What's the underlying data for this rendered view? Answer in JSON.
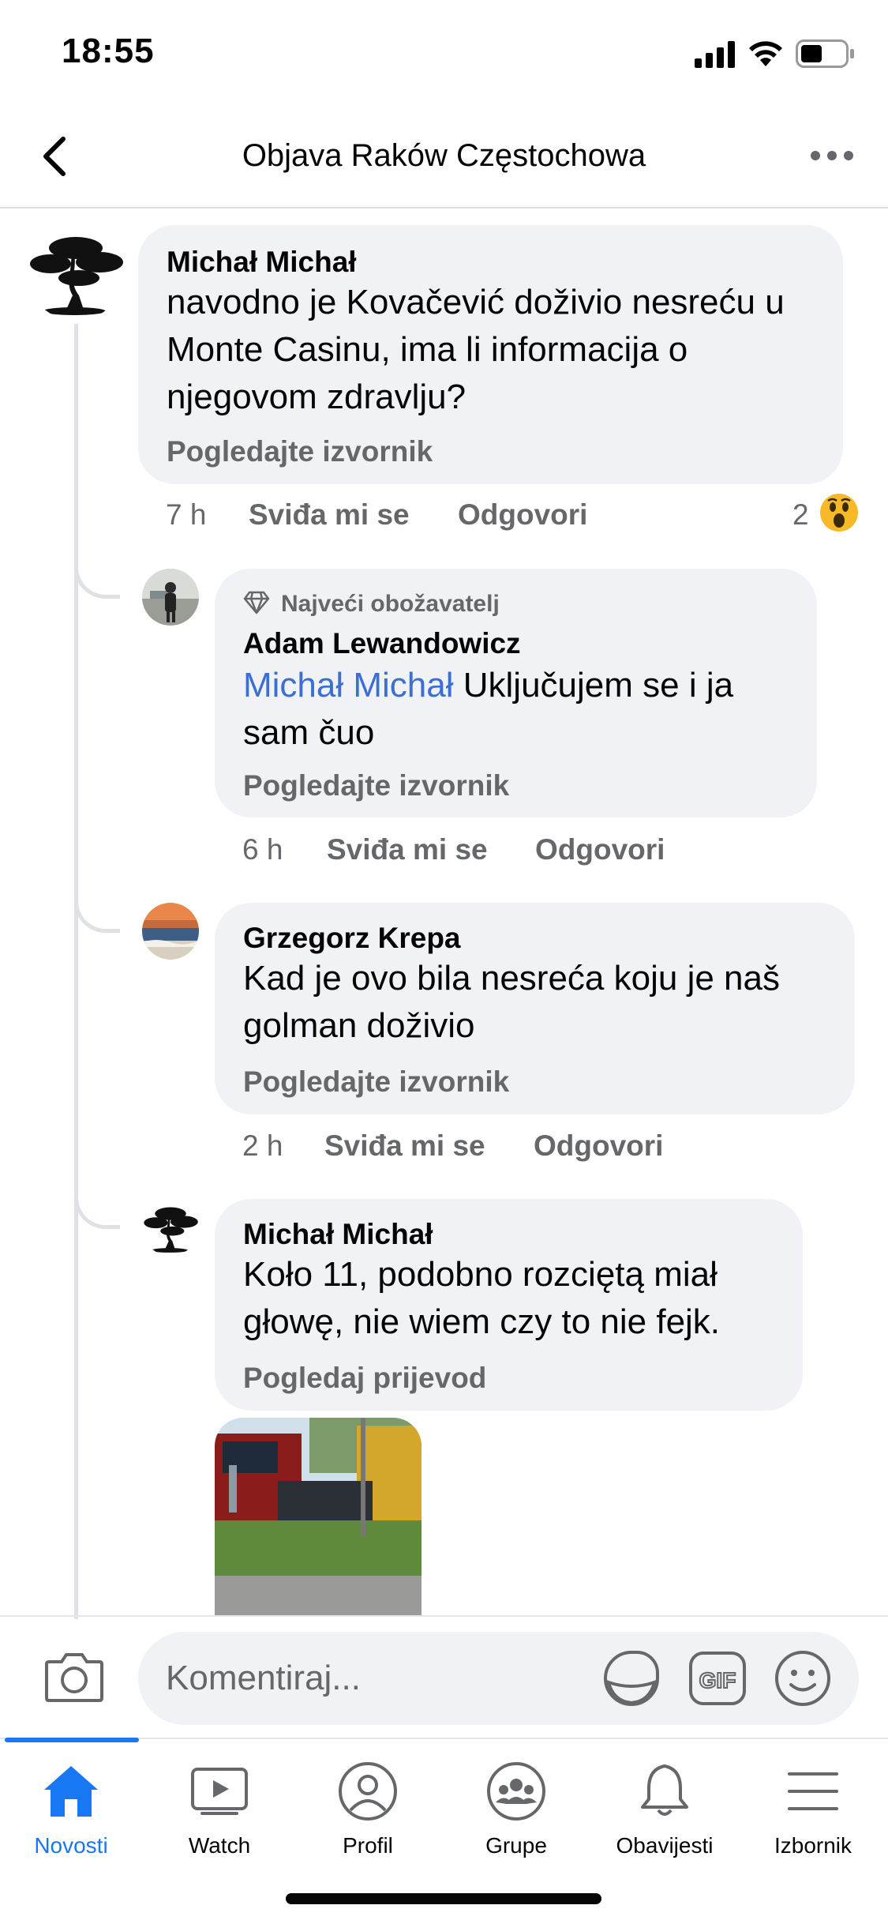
{
  "status_bar": {
    "time": "18:55"
  },
  "header": {
    "title": "Objava Raków Częstochowa"
  },
  "comments": [
    {
      "author": "Michał Michał",
      "text": "navodno je Kovačević doživio nesreću u Monte Casinu, ima li informacija o njegovom zdravlju?",
      "translation_link": "Pogledajte izvornik",
      "time": "7 h",
      "like": "Sviđa mi se",
      "reply": "Odgovori",
      "reaction_count": "2",
      "reaction_icon": "wow-emoji-icon"
    }
  ],
  "replies": [
    {
      "badge": "Najveći obožavatelj",
      "author": "Adam Lewandowicz",
      "mention": "Michał Michał",
      "text": " Uključujem se i ja sam čuo",
      "translation_link": "Pogledajte izvornik",
      "time": "6 h",
      "like": "Sviđa mi se",
      "reply": "Odgovori"
    },
    {
      "author": "Grzegorz Krepa",
      "text": "Kad je ovo bila nesreća koju je naš golman doživio",
      "translation_link": "Pogledajte izvornik",
      "time": "2 h",
      "like": "Sviđa mi se",
      "reply": "Odgovori"
    },
    {
      "author": "Michał Michał",
      "text": "Koło 11, podobno rozciętą miał głowę, nie wiem czy to nie fejk.",
      "translation_link": "Pogledaj prijevod"
    }
  ],
  "composer": {
    "placeholder": "Komentiraj..."
  },
  "tabs": [
    {
      "label": "Novosti",
      "icon": "home-icon",
      "active": true
    },
    {
      "label": "Watch",
      "icon": "watch-icon"
    },
    {
      "label": "Profil",
      "icon": "profile-icon"
    },
    {
      "label": "Grupe",
      "icon": "groups-icon"
    },
    {
      "label": "Obavijesti",
      "icon": "bell-icon"
    },
    {
      "label": "Izbornik",
      "icon": "menu-icon"
    }
  ],
  "colors": {
    "accent": "#1877f2",
    "bubble": "#f0f2f5",
    "secondary_text": "#65676b",
    "mention": "#3b6fd1"
  }
}
